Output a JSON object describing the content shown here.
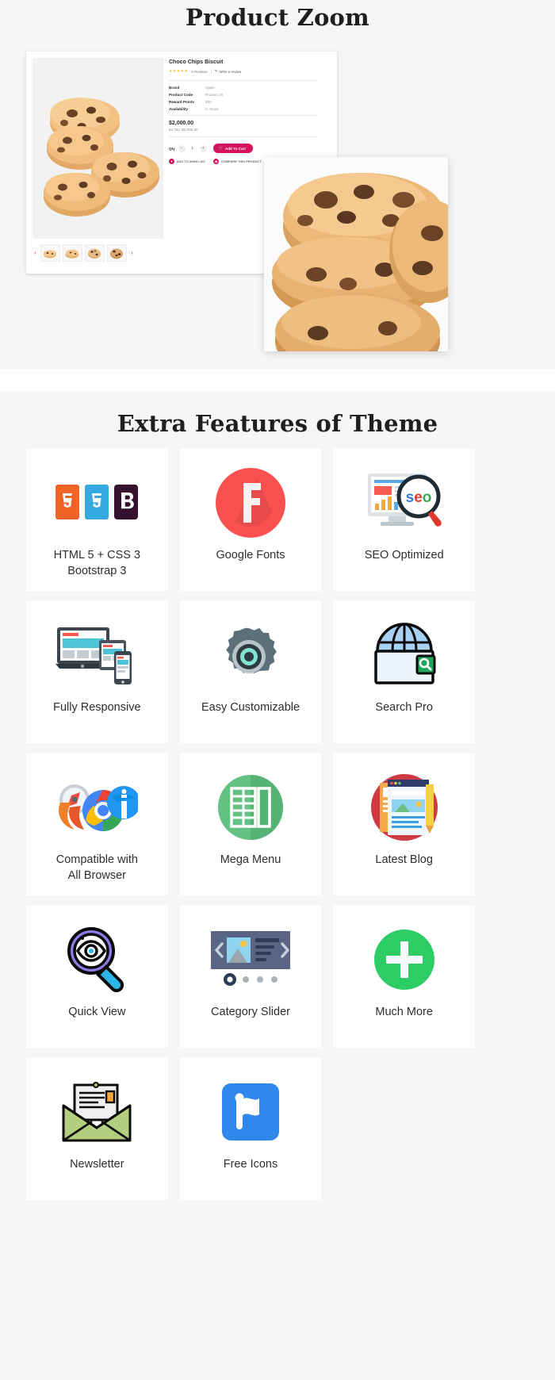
{
  "sections": {
    "product_zoom": {
      "title": "Product Zoom",
      "product": {
        "name": "Choco Chips Biscuit",
        "stars": "★★★★★",
        "reviews": "0 Reviews",
        "write_review": "Write a review",
        "specs": [
          {
            "key": "Brand",
            "value": "Apple"
          },
          {
            "key": "Product Code",
            "value": "Product 18"
          },
          {
            "key": "Reward Points",
            "value": "800"
          },
          {
            "key": "Availability",
            "value": "In Stock"
          }
        ],
        "price": "$2,000.00",
        "ex_tax": "Ex Tax: $2,000.00",
        "qty_label": "Qty",
        "qty_value": "1",
        "minus": "−",
        "plus": "+",
        "add_to_cart": "Add To Cart",
        "add_to_wishlist": "ADD TO WISH LIST",
        "compare_product": "COMPARE THIS PRODUCT",
        "thumb_prev": "‹",
        "thumb_next": "›",
        "thumb_count": 4
      }
    },
    "features": {
      "title": "Extra Features of Theme",
      "cards": [
        {
          "label": "HTML 5 + CSS 3\nBootstrap 3",
          "icon": "html5-css3-bootstrap-icon"
        },
        {
          "label": "Google Fonts",
          "icon": "google-fonts-icon"
        },
        {
          "label": "SEO Optimized",
          "icon": "seo-optimized-icon"
        },
        {
          "label": "Fully Responsive",
          "icon": "responsive-devices-icon"
        },
        {
          "label": "Easy Customizable",
          "icon": "gear-icon"
        },
        {
          "label": "Search Pro",
          "icon": "globe-search-icon"
        },
        {
          "label": "Compatible with\nAll Browser",
          "icon": "browsers-icon"
        },
        {
          "label": "Mega Menu",
          "icon": "mega-menu-icon"
        },
        {
          "label": "Latest Blog",
          "icon": "blog-icon"
        },
        {
          "label": "Quick View",
          "icon": "quick-view-icon"
        },
        {
          "label": "Category Slider",
          "icon": "category-slider-icon"
        },
        {
          "label": "Much More",
          "icon": "plus-circle-icon"
        },
        {
          "label": "Newsletter",
          "icon": "newsletter-envelope-icon"
        },
        {
          "label": "Free Icons",
          "icon": "flag-icon"
        }
      ]
    }
  },
  "colors": {
    "page_bg": "#f6f6f6",
    "card_bg": "#ffffff",
    "accent_pink": "#d6115d",
    "star_yellow": "#f5bf2f",
    "heading": "#211e1e",
    "label": "#2e2e2e"
  }
}
